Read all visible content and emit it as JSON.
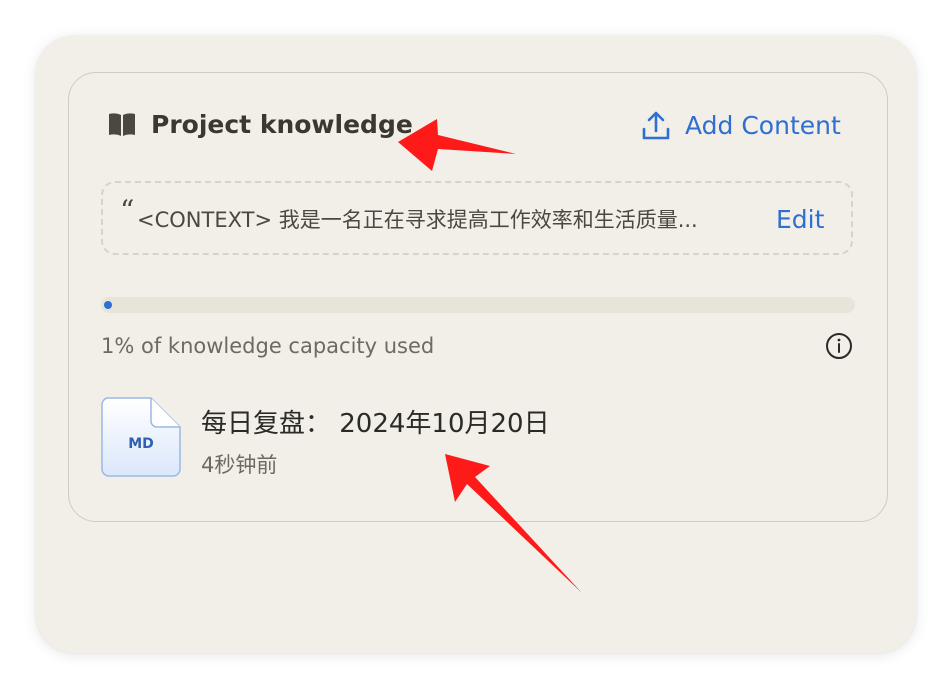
{
  "header": {
    "title": "Project knowledge",
    "title_icon": "book-open-icon",
    "add_content_label": "Add Content",
    "add_content_icon": "upload-icon"
  },
  "context": {
    "quote_mark": "“",
    "text": "<CONTEXT> 我是一名正在寻求提高工作效率和生活质量...",
    "edit_label": "Edit"
  },
  "capacity": {
    "label": "1% of knowledge capacity used",
    "percent": 1,
    "info_icon": "info-icon"
  },
  "files": [
    {
      "badge": "MD",
      "name": "每日复盘： 2024年10月20日",
      "time": "4秒钟前"
    }
  ],
  "colors": {
    "accent": "#2f6fd1",
    "background": "#f1efe8",
    "annotation_arrow": "#ff0000"
  }
}
